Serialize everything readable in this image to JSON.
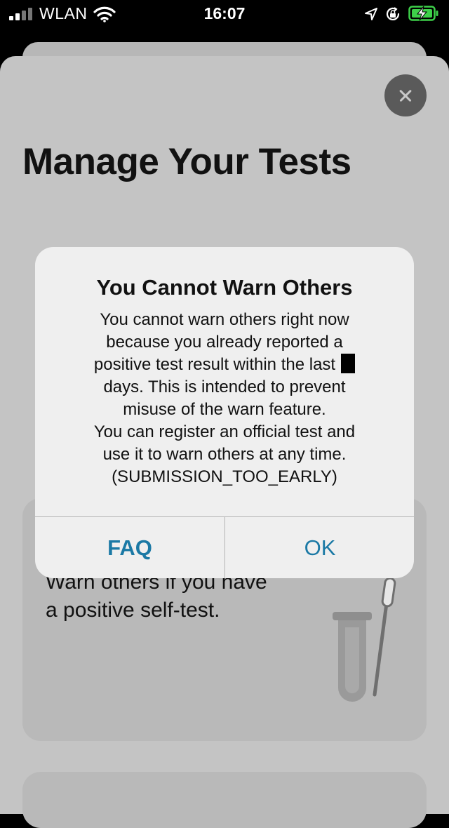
{
  "status_bar": {
    "carrier": "WLAN",
    "time": "16:07",
    "icons": [
      "signal-icon",
      "wifi-icon",
      "location-icon",
      "orientation-lock-icon",
      "battery-charging-icon"
    ],
    "battery_color": "#3ed14a"
  },
  "page": {
    "title": "Manage Your Tests",
    "close_icon": "close-icon"
  },
  "card": {
    "text_lines": [
      "Warn others if you have",
      "a positive self-test."
    ],
    "illustration": "test-tube-icon"
  },
  "alert": {
    "title": "You Cannot Warn Others",
    "message_lines": [
      "You cannot warn others right now",
      "because you already reported a",
      "positive test result within the last",
      "days. This is intended to prevent",
      "misuse of the warn feature.",
      "You can register an official test and",
      "use it to warn others at any time.",
      "(SUBMISSION_TOO_EARLY)"
    ],
    "faq_label": "FAQ",
    "ok_label": "OK",
    "accent_color": "#1b79a5"
  }
}
